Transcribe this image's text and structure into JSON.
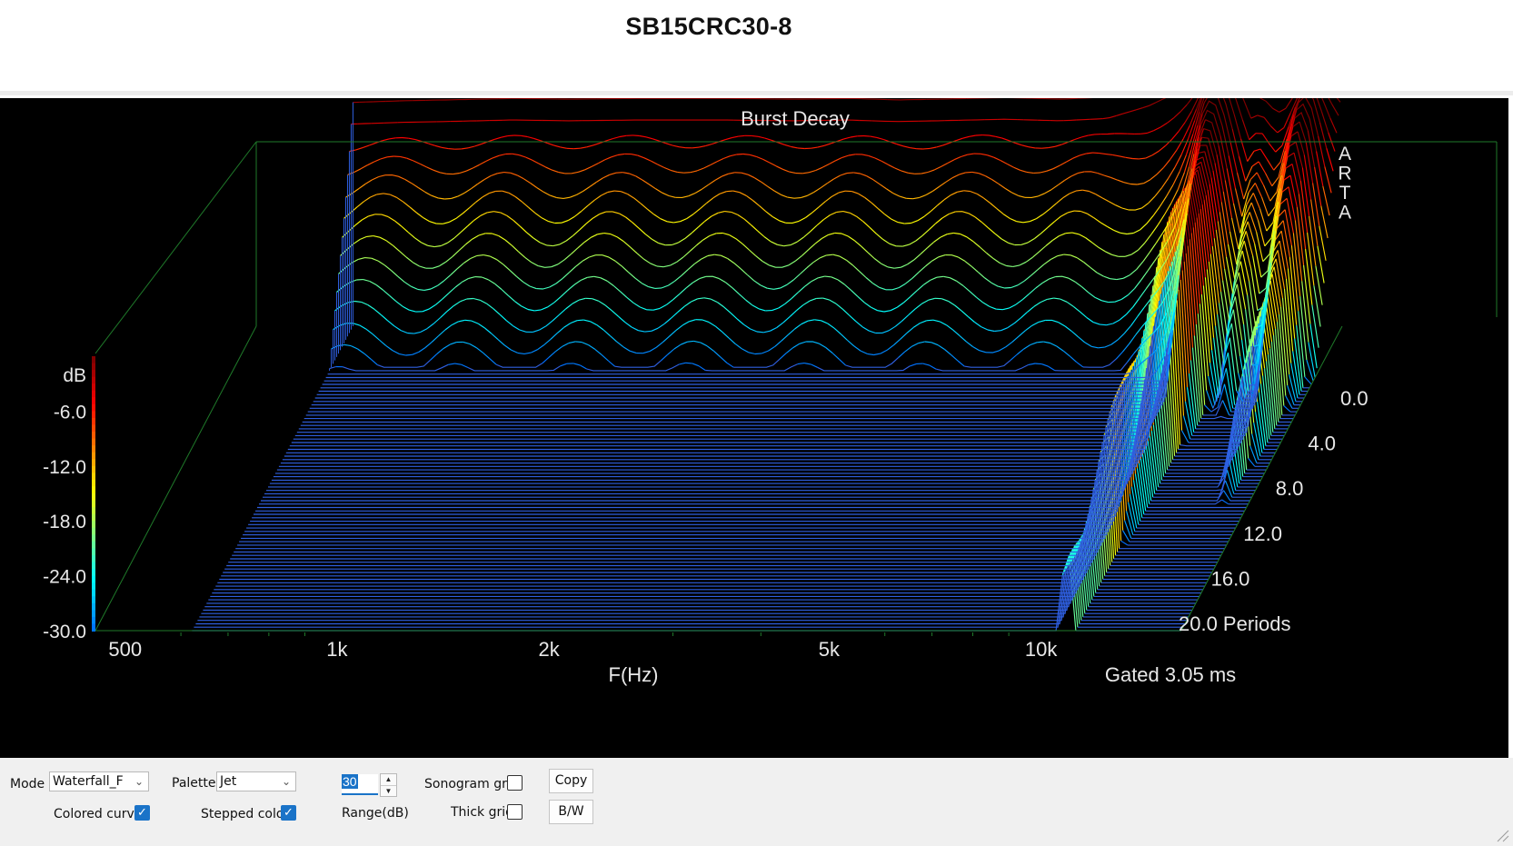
{
  "page_title": "SB15CRC30-8",
  "chart_data": {
    "type": "waterfall",
    "title": "Burst Decay",
    "watermark": "ARTA",
    "xlabel": "F(Hz)",
    "x_scale": "log",
    "x_ticks": [
      "500",
      "1k",
      "2k",
      "5k",
      "10k"
    ],
    "z_ticks": [
      "0.0",
      "4.0",
      "8.0",
      "12.0",
      "16.0",
      "20.0 Periods"
    ],
    "y_title": "dB",
    "y_ticks": [
      "-6.0",
      "-12.0",
      "-18.0",
      "-24.0",
      "-30.0"
    ],
    "ylim": [
      -30,
      0
    ],
    "zlim": [
      0,
      20
    ],
    "gate_note": "Gated 3.05 ms",
    "palette": "Jet",
    "colors": {
      "background": "#000000",
      "axis": "#1f7a2a",
      "floor": "#2f5fe0"
    },
    "front_curve": {
      "freq_hz": [
        430,
        500,
        600,
        700,
        800,
        1000,
        1200,
        1500,
        2000,
        2500,
        3000,
        3500,
        4000,
        5000,
        6000,
        7000,
        8000,
        9000,
        10000,
        11000,
        12000,
        13000,
        14000,
        15000
      ],
      "db": [
        -1.5,
        -1.2,
        -1.0,
        -0.8,
        -0.7,
        -0.5,
        -0.6,
        -0.5,
        -0.5,
        -0.6,
        -0.5,
        -0.7,
        -0.6,
        -0.4,
        -0.6,
        -0.3,
        1.3,
        3.5,
        5.2,
        5.5,
        2.8,
        4.0,
        3.8,
        1.5
      ]
    }
  },
  "controls": {
    "mode_label": "Mode",
    "mode_value": "Waterfall_F",
    "palette_label": "Palette",
    "palette_value": "Jet",
    "range_value": "30",
    "range_label": "Range(dB)",
    "sonogram_grid_label": "Sonogram grid",
    "sonogram_grid_checked": false,
    "thick_grid_label": "Thick grid",
    "thick_grid_checked": false,
    "colored_curves_label": "Colored curves",
    "colored_curves_checked": true,
    "stepped_colors_label": "Stepped colors",
    "stepped_colors_checked": true,
    "copy_label": "Copy",
    "bw_label": "B/W"
  }
}
